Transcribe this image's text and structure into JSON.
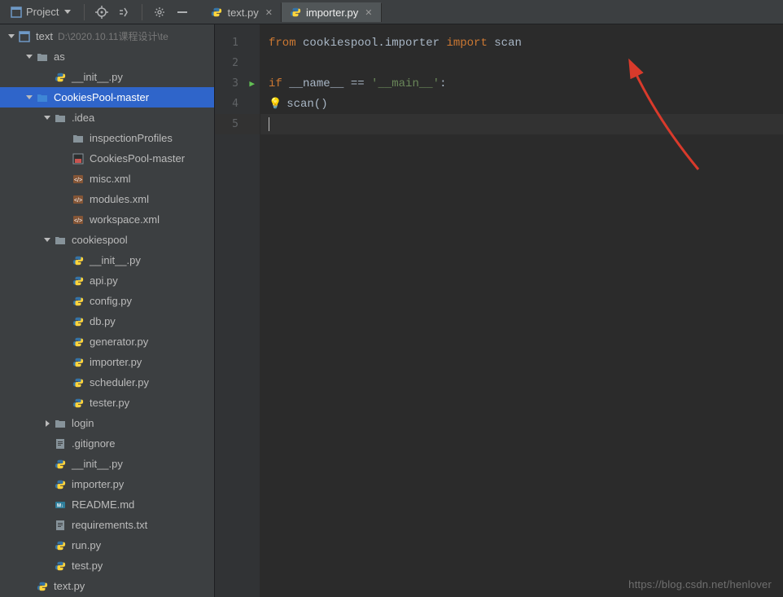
{
  "toolbar": {
    "project_label": "Project"
  },
  "tabs": [
    {
      "label": "text.py",
      "active": false
    },
    {
      "label": "importer.py",
      "active": true
    }
  ],
  "tree": {
    "root": {
      "name": "text",
      "path": "D:\\2020.10.11课程设计\\te"
    },
    "items": [
      {
        "indent": 0,
        "chev": "down",
        "icon": "project",
        "label": "text",
        "path": "D:\\2020.10.11课程设计\\te"
      },
      {
        "indent": 1,
        "chev": "down",
        "icon": "folder",
        "label": "as"
      },
      {
        "indent": 2,
        "chev": "",
        "icon": "py",
        "label": "__init__.py"
      },
      {
        "indent": 1,
        "chev": "down",
        "icon": "folder-blue",
        "label": "CookiesPool-master",
        "selected": true
      },
      {
        "indent": 2,
        "chev": "down",
        "icon": "folder",
        "label": ".idea"
      },
      {
        "indent": 3,
        "chev": "",
        "icon": "folder",
        "label": "inspectionProfiles"
      },
      {
        "indent": 3,
        "chev": "",
        "icon": "iml",
        "label": "CookiesPool-master"
      },
      {
        "indent": 3,
        "chev": "",
        "icon": "xml",
        "label": "misc.xml"
      },
      {
        "indent": 3,
        "chev": "",
        "icon": "xml",
        "label": "modules.xml"
      },
      {
        "indent": 3,
        "chev": "",
        "icon": "xml",
        "label": "workspace.xml"
      },
      {
        "indent": 2,
        "chev": "down",
        "icon": "folder",
        "label": "cookiespool"
      },
      {
        "indent": 3,
        "chev": "",
        "icon": "py",
        "label": "__init__.py"
      },
      {
        "indent": 3,
        "chev": "",
        "icon": "py",
        "label": "api.py"
      },
      {
        "indent": 3,
        "chev": "",
        "icon": "py",
        "label": "config.py"
      },
      {
        "indent": 3,
        "chev": "",
        "icon": "py",
        "label": "db.py"
      },
      {
        "indent": 3,
        "chev": "",
        "icon": "py",
        "label": "generator.py"
      },
      {
        "indent": 3,
        "chev": "",
        "icon": "py",
        "label": "importer.py"
      },
      {
        "indent": 3,
        "chev": "",
        "icon": "py",
        "label": "scheduler.py"
      },
      {
        "indent": 3,
        "chev": "",
        "icon": "py",
        "label": "tester.py"
      },
      {
        "indent": 2,
        "chev": "right",
        "icon": "folder",
        "label": "login"
      },
      {
        "indent": 2,
        "chev": "",
        "icon": "txt",
        "label": ".gitignore"
      },
      {
        "indent": 2,
        "chev": "",
        "icon": "py",
        "label": "__init__.py"
      },
      {
        "indent": 2,
        "chev": "",
        "icon": "py",
        "label": "importer.py"
      },
      {
        "indent": 2,
        "chev": "",
        "icon": "md",
        "label": "README.md"
      },
      {
        "indent": 2,
        "chev": "",
        "icon": "txt",
        "label": "requirements.txt"
      },
      {
        "indent": 2,
        "chev": "",
        "icon": "py",
        "label": "run.py"
      },
      {
        "indent": 2,
        "chev": "",
        "icon": "py",
        "label": "test.py"
      },
      {
        "indent": 1,
        "chev": "",
        "icon": "py",
        "label": "text.py"
      }
    ]
  },
  "code": {
    "lines": [
      {
        "n": "1",
        "tokens": [
          {
            "cls": "kw",
            "t": "from "
          },
          {
            "cls": "ident",
            "t": "cookiespool.importer "
          },
          {
            "cls": "kw",
            "t": "import "
          },
          {
            "cls": "ident",
            "t": "scan"
          }
        ]
      },
      {
        "n": "2",
        "tokens": []
      },
      {
        "n": "3",
        "run": true,
        "tokens": [
          {
            "cls": "kw",
            "t": "if "
          },
          {
            "cls": "ident",
            "t": "__name__ == "
          },
          {
            "cls": "str",
            "t": "'__main__'"
          },
          {
            "cls": "txt",
            "t": ":"
          }
        ]
      },
      {
        "n": "4",
        "bulb": true,
        "tokens": [
          {
            "cls": "txt",
            "t": "    scan()"
          }
        ]
      },
      {
        "n": "5",
        "current": true,
        "tokens": []
      }
    ]
  },
  "watermark": "https://blog.csdn.net/henlover"
}
